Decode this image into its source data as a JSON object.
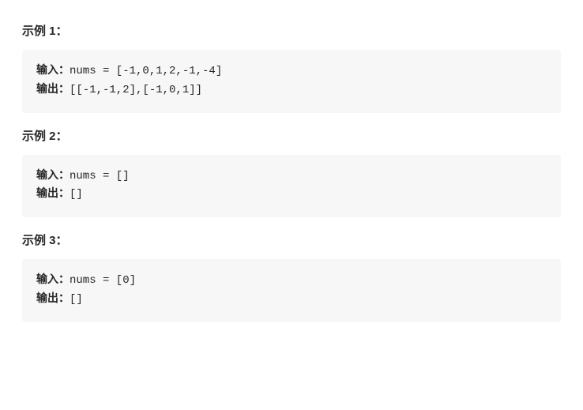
{
  "examples": [
    {
      "heading": "示例 1：",
      "inputLabel": "输入：",
      "inputValue": "nums = [-1,0,1,2,-1,-4]",
      "outputLabel": "输出：",
      "outputValue": "[[-1,-1,2],[-1,0,1]]"
    },
    {
      "heading": "示例 2：",
      "inputLabel": "输入：",
      "inputValue": "nums = []",
      "outputLabel": "输出：",
      "outputValue": "[]"
    },
    {
      "heading": "示例 3：",
      "inputLabel": "输入：",
      "inputValue": "nums = [0]",
      "outputLabel": "输出：",
      "outputValue": "[]"
    }
  ]
}
